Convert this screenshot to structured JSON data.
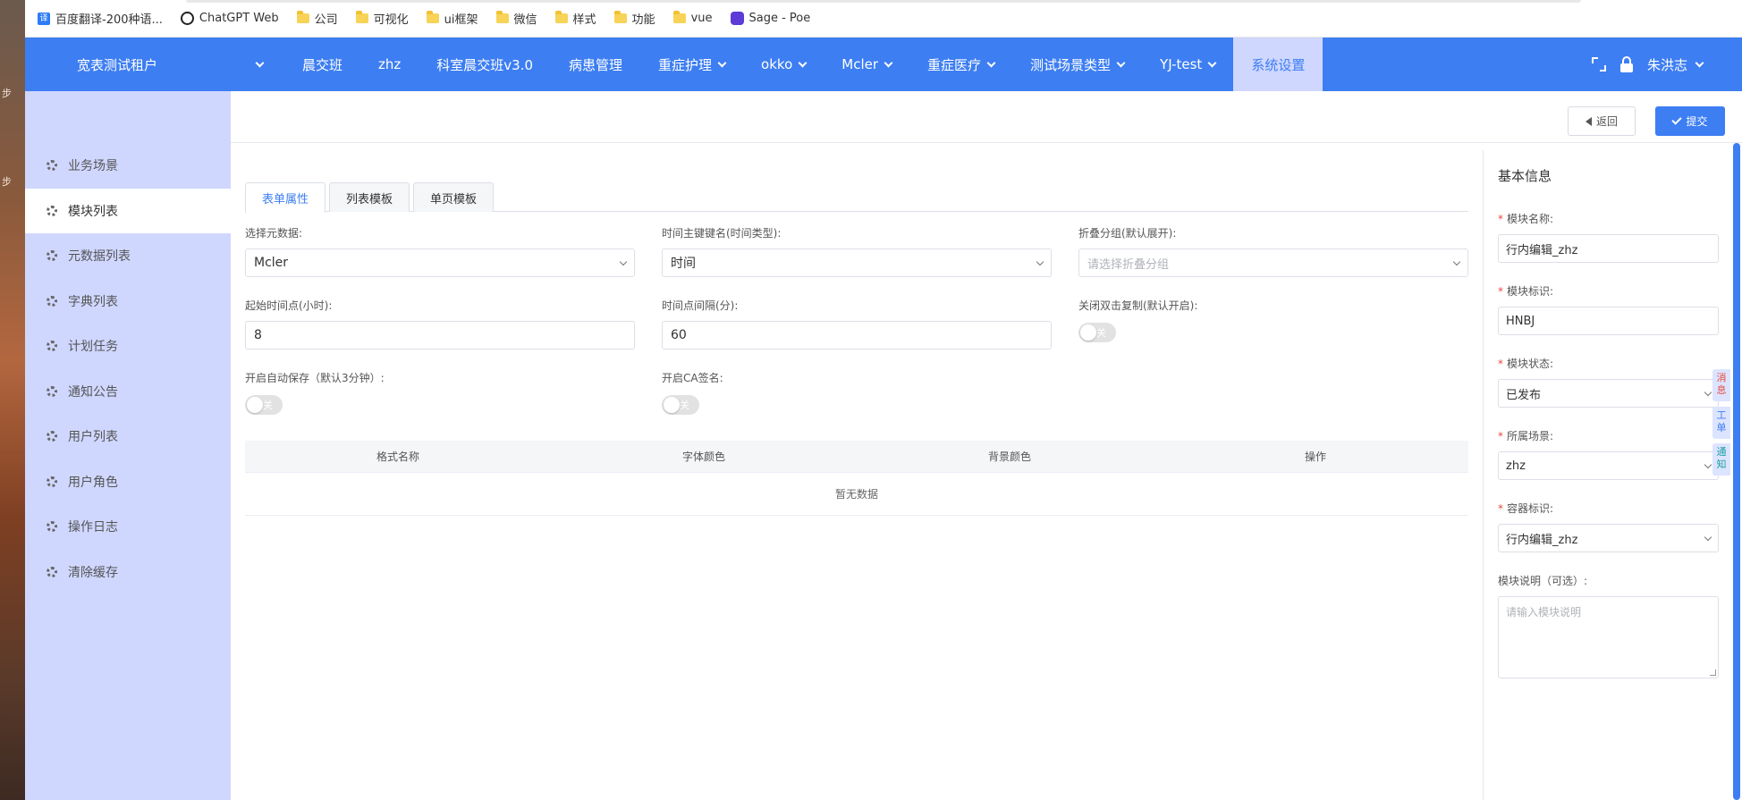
{
  "bookmarks": [
    {
      "label": "百度翻译-200种语...",
      "icon": "translate-icon"
    },
    {
      "label": "ChatGPT Web",
      "icon": "chatgpt-icon"
    },
    {
      "label": "公司",
      "icon": "folder-icon"
    },
    {
      "label": "可视化",
      "icon": "folder-icon"
    },
    {
      "label": "ui框架",
      "icon": "folder-icon"
    },
    {
      "label": "微信",
      "icon": "folder-icon"
    },
    {
      "label": "样式",
      "icon": "folder-icon"
    },
    {
      "label": "功能",
      "icon": "folder-icon"
    },
    {
      "label": "vue",
      "icon": "folder-icon"
    },
    {
      "label": "Sage - Poe",
      "icon": "poe-icon"
    }
  ],
  "topnav": {
    "tenant": "宽表测试租户",
    "items": [
      {
        "label": "晨交班",
        "dropdown": false
      },
      {
        "label": "zhz",
        "dropdown": false
      },
      {
        "label": "科室晨交班v3.0",
        "dropdown": false
      },
      {
        "label": "病患管理",
        "dropdown": false
      },
      {
        "label": "重症护理",
        "dropdown": true
      },
      {
        "label": "okko",
        "dropdown": true
      },
      {
        "label": "Mcler",
        "dropdown": true
      },
      {
        "label": "重症医疗",
        "dropdown": true
      },
      {
        "label": "测试场景类型",
        "dropdown": true
      },
      {
        "label": "YJ-test",
        "dropdown": true
      },
      {
        "label": "系统设置",
        "dropdown": false,
        "active": true
      }
    ],
    "user": "朱洪志"
  },
  "sidebar": {
    "items": [
      {
        "label": "业务场景"
      },
      {
        "label": "模块列表",
        "active": true
      },
      {
        "label": "元数据列表"
      },
      {
        "label": "字典列表"
      },
      {
        "label": "计划任务"
      },
      {
        "label": "通知公告"
      },
      {
        "label": "用户列表"
      },
      {
        "label": "用户角色"
      },
      {
        "label": "操作日志"
      },
      {
        "label": "清除缓存"
      }
    ]
  },
  "actions": {
    "back": "返回",
    "submit": "提交"
  },
  "tabs": [
    "表单属性",
    "列表模板",
    "单页模板"
  ],
  "form": {
    "metadata": {
      "label": "选择元数据:",
      "value": "Mcler"
    },
    "time_key": {
      "label": "时间主键键名(时间类型):",
      "value": "时间"
    },
    "fold_group": {
      "label": "折叠分组(默认展开):",
      "placeholder": "请选择折叠分组"
    },
    "start_hour": {
      "label": "起始时间点(小时):",
      "value": "8"
    },
    "interval": {
      "label": "时间点间隔(分):",
      "value": "60"
    },
    "dblclick_copy": {
      "label": "关闭双击复制(默认开启):",
      "state": "关"
    },
    "autosave": {
      "label": "开启自动保存（默认3分钟）:",
      "state": "关"
    },
    "ca_sign": {
      "label": "开启CA签名:",
      "state": "关"
    }
  },
  "table": {
    "headers": [
      "格式名称",
      "字体颜色",
      "背景颜色",
      "操作"
    ],
    "empty": "暂无数据"
  },
  "right_panel": {
    "title": "基本信息",
    "module_name": {
      "label": "模块名称:",
      "value": "行内编辑_zhz"
    },
    "module_id": {
      "label": "模块标识:",
      "value": "HNBJ"
    },
    "module_status": {
      "label": "模块状态:",
      "value": "已发布"
    },
    "scene": {
      "label": "所属场景:",
      "value": "zhz"
    },
    "container": {
      "label": "容器标识:",
      "value": "行内编辑_zhz"
    },
    "desc": {
      "label": "模块说明（可选）:",
      "placeholder": "请输入模块说明"
    }
  },
  "float_tabs": [
    "消息",
    "工单",
    "通知"
  ],
  "colors": {
    "primary": "#3d7ef2",
    "sidebar_bg": "#cfd7ff",
    "required": "#e74c3c"
  }
}
